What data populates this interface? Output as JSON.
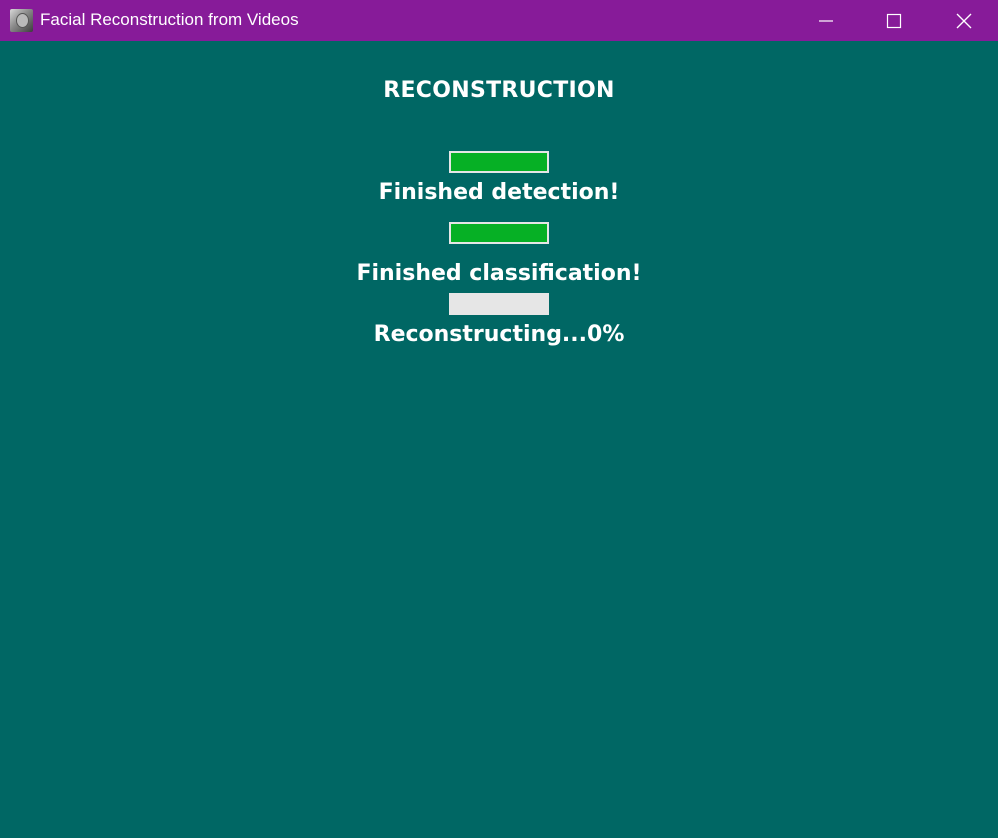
{
  "window": {
    "title": "Facial Reconstruction from Videos",
    "titlebar_color": "#871b99",
    "background_color": "#006764",
    "icon": "app-face-icon"
  },
  "window_controls": {
    "minimize_icon": "minimize-icon",
    "maximize_icon": "maximize-icon",
    "close_icon": "close-icon"
  },
  "main": {
    "heading": "RECONSTRUCTION",
    "progress_fill_color": "#06b025",
    "progress_track_color": "#e6e6e6",
    "steps": [
      {
        "progress": 1.0,
        "status": "Finished detection!"
      },
      {
        "progress": 1.0,
        "status": "Finished classification!"
      },
      {
        "progress": 0.0,
        "status": "Reconstructing...0%"
      }
    ]
  }
}
